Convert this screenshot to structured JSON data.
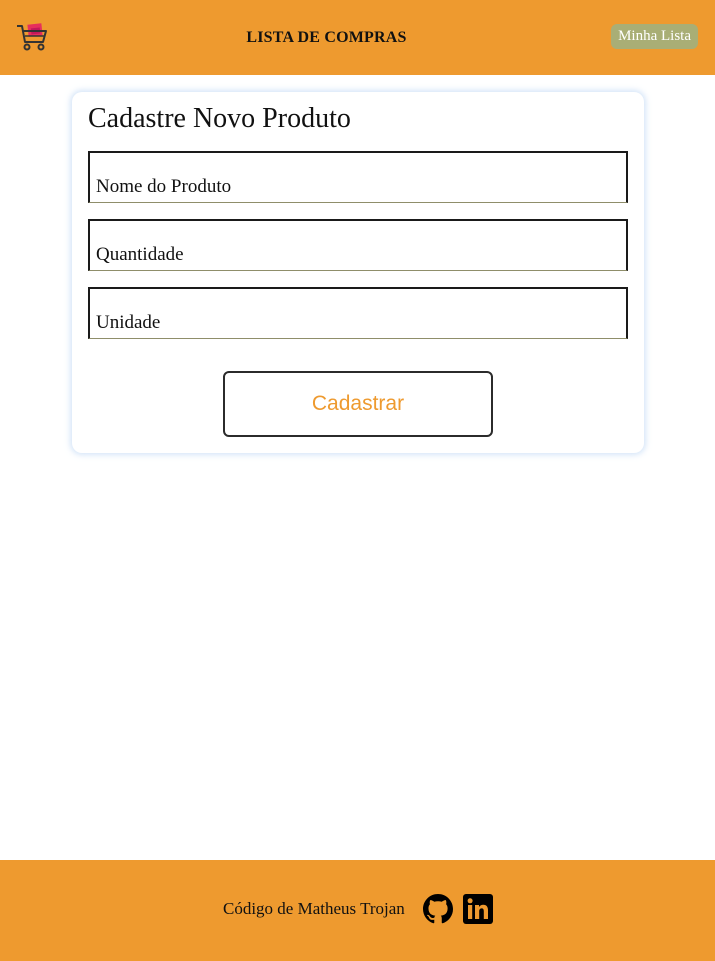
{
  "header": {
    "logo_icon": "shopping-cart-icon",
    "title": "LISTA DE COMPRAS",
    "my_list_button": "Minha Lista",
    "background_color": "#ee9a2f",
    "button_color": "#a9ae75"
  },
  "form": {
    "title": "Cadastre Novo Produto",
    "fields": {
      "product_name": {
        "placeholder": "Nome do Produto",
        "value": ""
      },
      "quantity": {
        "placeholder": "Quantidade",
        "value": ""
      },
      "unit": {
        "placeholder": "Unidade",
        "value": ""
      }
    },
    "submit_button": "Cadastrar",
    "submit_text_color": "#ee9a2f"
  },
  "footer": {
    "credit": "Código de Matheus Trojan",
    "icons": [
      "github-icon",
      "linkedin-icon"
    ],
    "background_color": "#ee9a2f"
  }
}
